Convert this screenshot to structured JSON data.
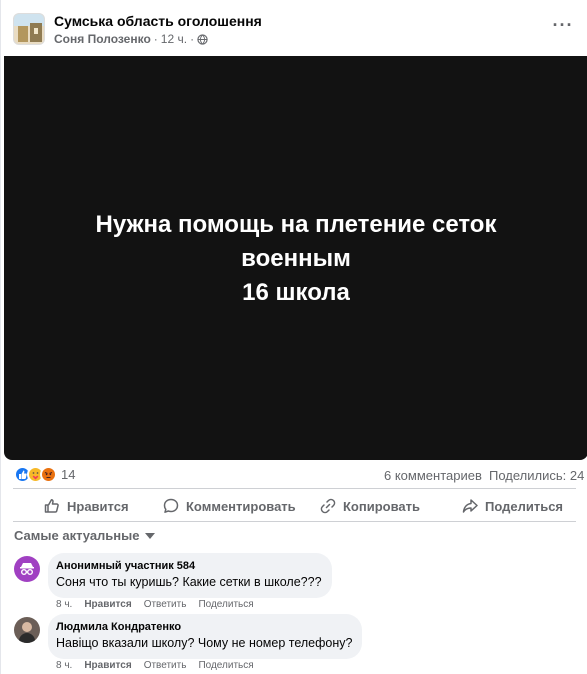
{
  "post": {
    "group_name": "Сумська область оголошення",
    "author": "Соня Полозенко",
    "time": "12 ч.",
    "separator": "·",
    "privacy_icon": "globe-icon",
    "more_icon": "more-dots-icon",
    "image_text": [
      "Нужна помощь на плетение сеток",
      "военным",
      "16 школа"
    ]
  },
  "stats": {
    "reaction_icons": [
      "like",
      "care",
      "angry"
    ],
    "reaction_count": "14",
    "comments_count": "6 комментариев",
    "shares_count": "Поделились: 24"
  },
  "actions": {
    "like": "Нравится",
    "comment": "Комментировать",
    "copy": "Копировать",
    "share": "Поделиться"
  },
  "filter": {
    "label": "Самые актуальные"
  },
  "comments": [
    {
      "author": "Анонимный участник 584",
      "text": "Соня что ты куришь? Какие сетки в школе???",
      "time": "8 ч.",
      "like": "Нравится",
      "reply": "Ответить",
      "share": "Поделиться"
    },
    {
      "author": "Людмила Кондратенко",
      "text": "Навіщо вказали школу? Чому не номер телефону?",
      "time": "8 ч.",
      "like": "Нравится",
      "reply": "Ответить",
      "share": "Поделиться"
    }
  ],
  "colors": {
    "image_background": "#121212",
    "muted_text": "#65676b",
    "bubble": "#f0f2f5",
    "like_blue": "#1877f2"
  }
}
